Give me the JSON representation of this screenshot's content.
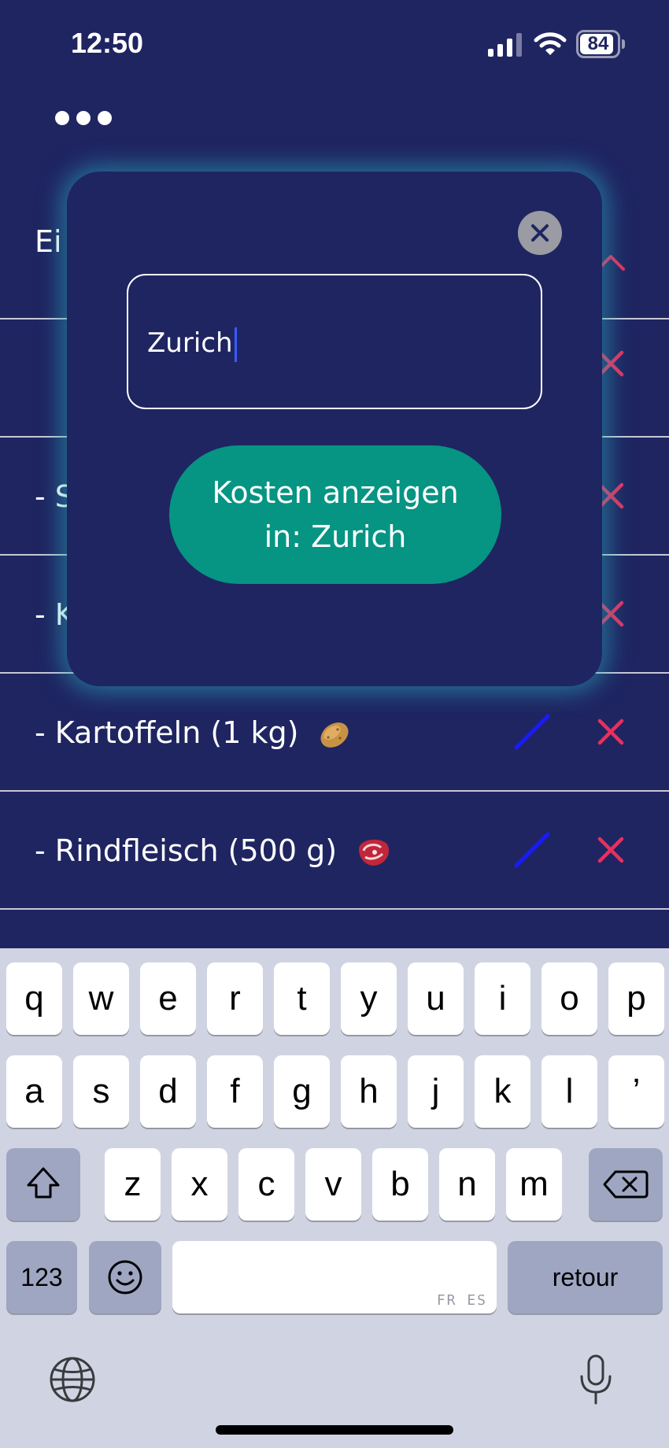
{
  "status_bar": {
    "time": "12:50",
    "battery_level": "84",
    "battery_fraction": 0.84,
    "icons": [
      "cellular-signal-icon",
      "wifi-icon",
      "battery-icon"
    ]
  },
  "menu": {
    "icon": "more-dots-icon"
  },
  "list": {
    "items": [
      {
        "label": "Ei",
        "emoji": "",
        "has_edit": false,
        "control": "chevron-up-icon"
      },
      {
        "label": "",
        "emoji": "",
        "has_edit": false,
        "control": "delete-icon"
      },
      {
        "label": "- S",
        "emoji": "",
        "has_edit": false,
        "control": "delete-icon"
      },
      {
        "label": "- K",
        "emoji": "",
        "has_edit": false,
        "control": "delete-icon"
      },
      {
        "label": "- Kartoffeln (1 kg)",
        "emoji": "potato",
        "has_edit": true,
        "control": "delete-icon"
      },
      {
        "label": "- Rindfleisch (500 g)",
        "emoji": "steak",
        "has_edit": true,
        "control": "delete-icon"
      }
    ]
  },
  "modal": {
    "input_value": "Zurich",
    "button_label": "Kosten anzeigen in: Zurich",
    "close_icon": "close-icon"
  },
  "keyboard": {
    "row1": [
      "q",
      "w",
      "e",
      "r",
      "t",
      "y",
      "u",
      "i",
      "o",
      "p"
    ],
    "row2": [
      "a",
      "s",
      "d",
      "f",
      "g",
      "h",
      "j",
      "k",
      "l",
      "’"
    ],
    "row3": [
      "z",
      "x",
      "c",
      "v",
      "b",
      "n",
      "m"
    ],
    "numbers_label": "123",
    "return_label": "retour",
    "space_languages": "FR ES",
    "icons": [
      "shift-icon",
      "backspace-icon",
      "emoji-icon",
      "globe-icon",
      "microphone-icon"
    ]
  },
  "colors": {
    "background": "#1f2561",
    "accent_button": "#069483",
    "delete": "#e8305f",
    "edit": "#1a1aff",
    "caret": "#3b5bff",
    "modal_glow": "#28aabe"
  }
}
